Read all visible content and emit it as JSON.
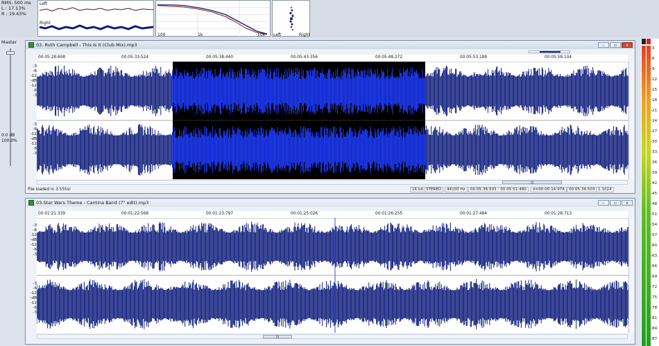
{
  "top": {
    "rms": {
      "title": "RMS: 500 ms",
      "left": "L : 17.13%",
      "right": "R : 19.43%"
    },
    "lr_plot": {
      "left_label": "Left",
      "right_label": "Right"
    },
    "spectrum": {
      "ticks": [
        "100",
        "1k",
        "10k"
      ]
    },
    "scope": {
      "left_label": "Left",
      "right_label": "Right"
    }
  },
  "master": {
    "label": "Master",
    "db": "0.0 dB",
    "pct": "100.0%"
  },
  "meter_scale": [
    "-3",
    "-6",
    "-9",
    "-12",
    "-15",
    "-18",
    "-21",
    "-24",
    "-27",
    "-30",
    "-33",
    "-36",
    "-39",
    "-42",
    "-45",
    "-48",
    "-51",
    "-54",
    "-57",
    "-60",
    "-63",
    "-66",
    "-69",
    "-72",
    "-75",
    "-78",
    "-81",
    "-84",
    "-87"
  ],
  "win1": {
    "title": "03. Ruth Campbell - This Is It (Club Mix).mp3",
    "ticks": [
      "00:05:28:608",
      "00:05:33:524",
      "00:05:38:440",
      "00:05:43:356",
      "00:05:48:272",
      "00:05:53:188",
      "00:05:58:104"
    ],
    "ylabels": [
      "-3",
      "-6",
      "-12",
      "-dB",
      "-12",
      "-6",
      "-3"
    ],
    "status": "File loaded in 3.555s!",
    "fields": [
      "16 bit",
      "STEREO",
      "44100 Hz",
      "00:05:36:503 - 00:05:51:480",
      "d=00:00:14:976",
      "00:05:36:503",
      "1:1024"
    ]
  },
  "win2": {
    "title": "03-Star Wars Theme - Cantina Band (7\" edit).mp3",
    "ticks": [
      "00:01:21:339",
      "00:01:22:568",
      "00:01:23:797",
      "00:01:25:026",
      "00:01:26:255",
      "00:01:27:484",
      "00:01:28:713"
    ],
    "ylabels": [
      "-3",
      "-6",
      "-12",
      "-dB",
      "-12",
      "-6",
      "-3"
    ]
  },
  "colors": {
    "wave": "#0b1a7a",
    "wave_sel": "#1f3cff",
    "selection": "#000000"
  }
}
